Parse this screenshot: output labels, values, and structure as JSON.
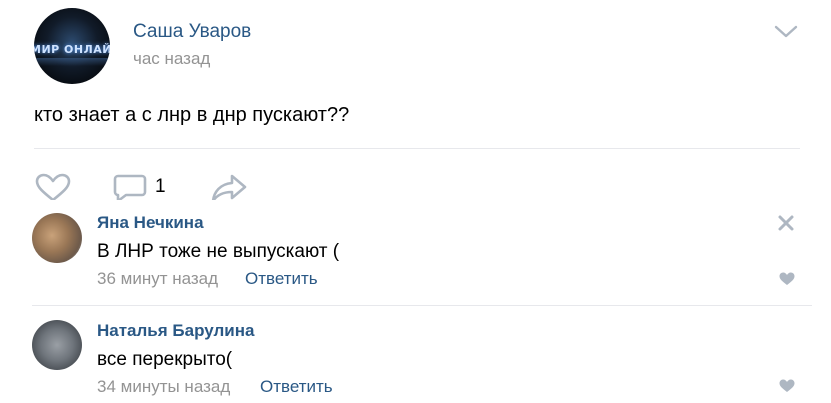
{
  "post": {
    "author": "Саша Уваров",
    "time": "час назад",
    "text": "кто знает а с лнр в днр пускают??",
    "avatar_logo_text": "МИР ОНЛАЙН",
    "menu_icon": "chevron-down-icon"
  },
  "actions": {
    "like_icon": "heart-icon",
    "comment_icon": "comment-icon",
    "comment_count": "1",
    "share_icon": "share-arrow-icon"
  },
  "comments": [
    {
      "author": "Яна Нечкина",
      "text": "В ЛНР тоже не выпускают (",
      "time": "36 минут назад",
      "reply_label": "Ответить"
    },
    {
      "author": "Наталья Барулина",
      "text": "все перекрыто(",
      "time": "34 минуты назад",
      "reply_label": "Ответить"
    }
  ],
  "colors": {
    "link": "#2a5885",
    "meta": "#939393",
    "icon": "#aeb7c2",
    "divider": "#e7e8ec"
  }
}
